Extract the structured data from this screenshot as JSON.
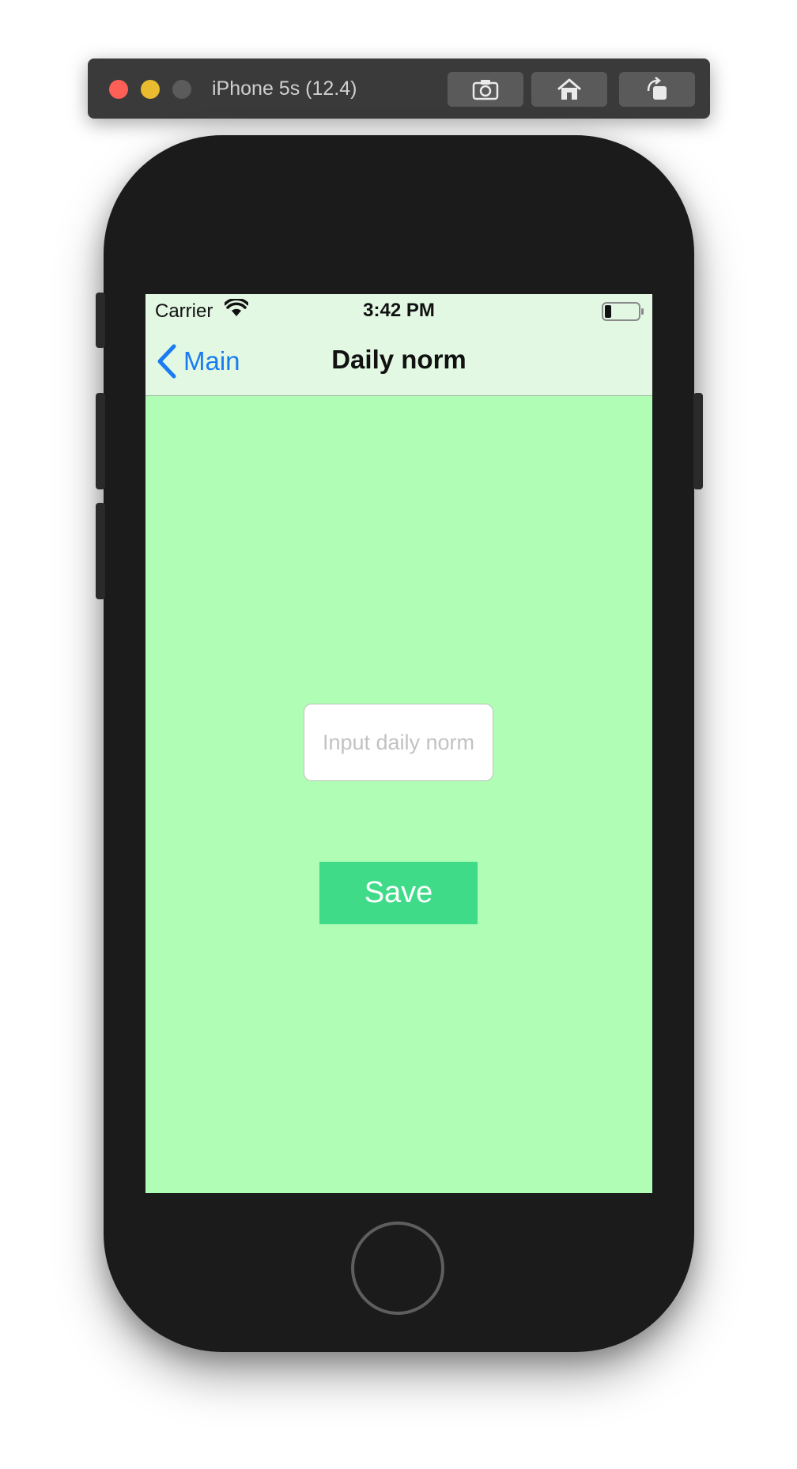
{
  "simulator": {
    "title": "iPhone 5s (12.4)",
    "controls": [
      {
        "name": "screenshot",
        "icon": "camera-icon"
      },
      {
        "name": "home",
        "icon": "home-icon"
      },
      {
        "name": "rotate",
        "icon": "rotate-icon"
      }
    ],
    "traffic_colors": {
      "close": "#fe5f57",
      "minimize": "#e9bb2e",
      "zoom": "#5b5b5b"
    }
  },
  "status_bar": {
    "carrier": "Carrier",
    "time": "3:42 PM",
    "wifi_icon": "wifi-icon",
    "battery_icon": "battery-icon",
    "battery_level": 0.2
  },
  "nav": {
    "back_label": "Main",
    "title": "Daily norm"
  },
  "form": {
    "input_placeholder": "Input daily norm",
    "input_value": "",
    "save_label": "Save"
  },
  "colors": {
    "screen_background": "#b0fdb5",
    "navbar_background": "#e2f8e3",
    "accent_blue": "#1a7cf2",
    "save_button": "#3fdb89",
    "device_body": "#1b1b1b"
  }
}
